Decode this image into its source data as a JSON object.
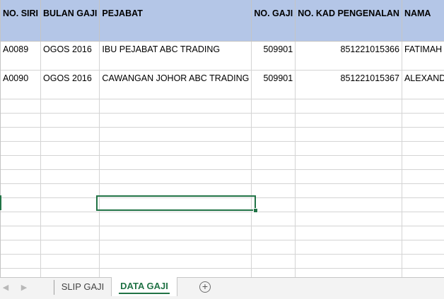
{
  "columns": [
    {
      "label": "NO. SIRI"
    },
    {
      "label": "BULAN GAJI"
    },
    {
      "label": "PEJABAT"
    },
    {
      "label": "NO. GAJI"
    },
    {
      "label": "NO. KAD PENGENALAN"
    },
    {
      "label": "NAMA"
    }
  ],
  "rows": [
    [
      "A0089",
      "OGOS 2016",
      "IBU PEJABAT ABC TRADING",
      "509901",
      "851221015366",
      "FATIMAH"
    ],
    [
      "A0090",
      "OGOS 2016",
      "CAWANGAN JOHOR ABC TRADING",
      "509901",
      "851221015367",
      "ALEXANDER"
    ]
  ],
  "sheet_tabs": [
    {
      "label": "SLIP GAJI",
      "active": false
    },
    {
      "label": "DATA GAJI",
      "active": true
    }
  ],
  "nav": {
    "prev_icon": "triangle-left-icon",
    "next_icon": "triangle-right-icon",
    "add_icon": "plus-circle-icon"
  },
  "colors": {
    "header_fill": "#b4c6e7",
    "accent": "#217346",
    "gridline": "#d4d4d4"
  }
}
